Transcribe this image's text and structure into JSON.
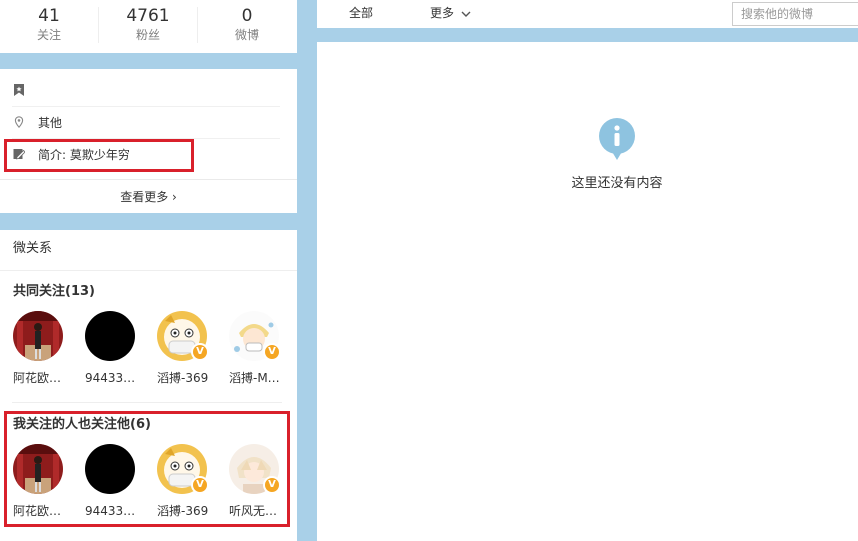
{
  "stats": [
    {
      "value": "41",
      "label": "关注"
    },
    {
      "value": "4761",
      "label": "粉丝"
    },
    {
      "value": "0",
      "label": "微博"
    }
  ],
  "info": {
    "location_text": "其他",
    "bio_text": "简介:  莫欺少年穷",
    "more_label": "查看更多 ›",
    "icons": [
      "bookmark-icon",
      "location-pin-icon",
      "edit-icon"
    ]
  },
  "relations": {
    "title": "微关系",
    "common_follow": {
      "title": "共同关注(13)",
      "users": [
        {
          "name": "阿花欧…",
          "avatar": "red-room-photo",
          "verified": false
        },
        {
          "name": "94433…",
          "avatar": "black-circle",
          "verified": false
        },
        {
          "name": "滔搏-369",
          "avatar": "cartoon-cat",
          "verified": true
        },
        {
          "name": "滔搏-M…",
          "avatar": "cartoon-boy",
          "verified": true
        }
      ]
    },
    "followed_by_follows": {
      "title": "我关注的人也关注他(6)",
      "users": [
        {
          "name": "阿花欧…",
          "avatar": "red-room-photo",
          "verified": false
        },
        {
          "name": "94433…",
          "avatar": "black-circle",
          "verified": false
        },
        {
          "name": "滔搏-369",
          "avatar": "cartoon-cat",
          "verified": true
        },
        {
          "name": "听风无…",
          "avatar": "anime-character",
          "verified": true
        }
      ]
    },
    "verified_badge": "V"
  },
  "tabs": {
    "all_label": "全部",
    "more_label": "更多"
  },
  "search": {
    "placeholder": "搜索他的微博"
  },
  "feed": {
    "empty_text": "这里还没有内容"
  },
  "colors": {
    "page_bg": "#a9d0e8",
    "highlight_box": "#d9202b",
    "verified_badge": "#f5a623",
    "empty_icon": "#8ec3e0"
  }
}
